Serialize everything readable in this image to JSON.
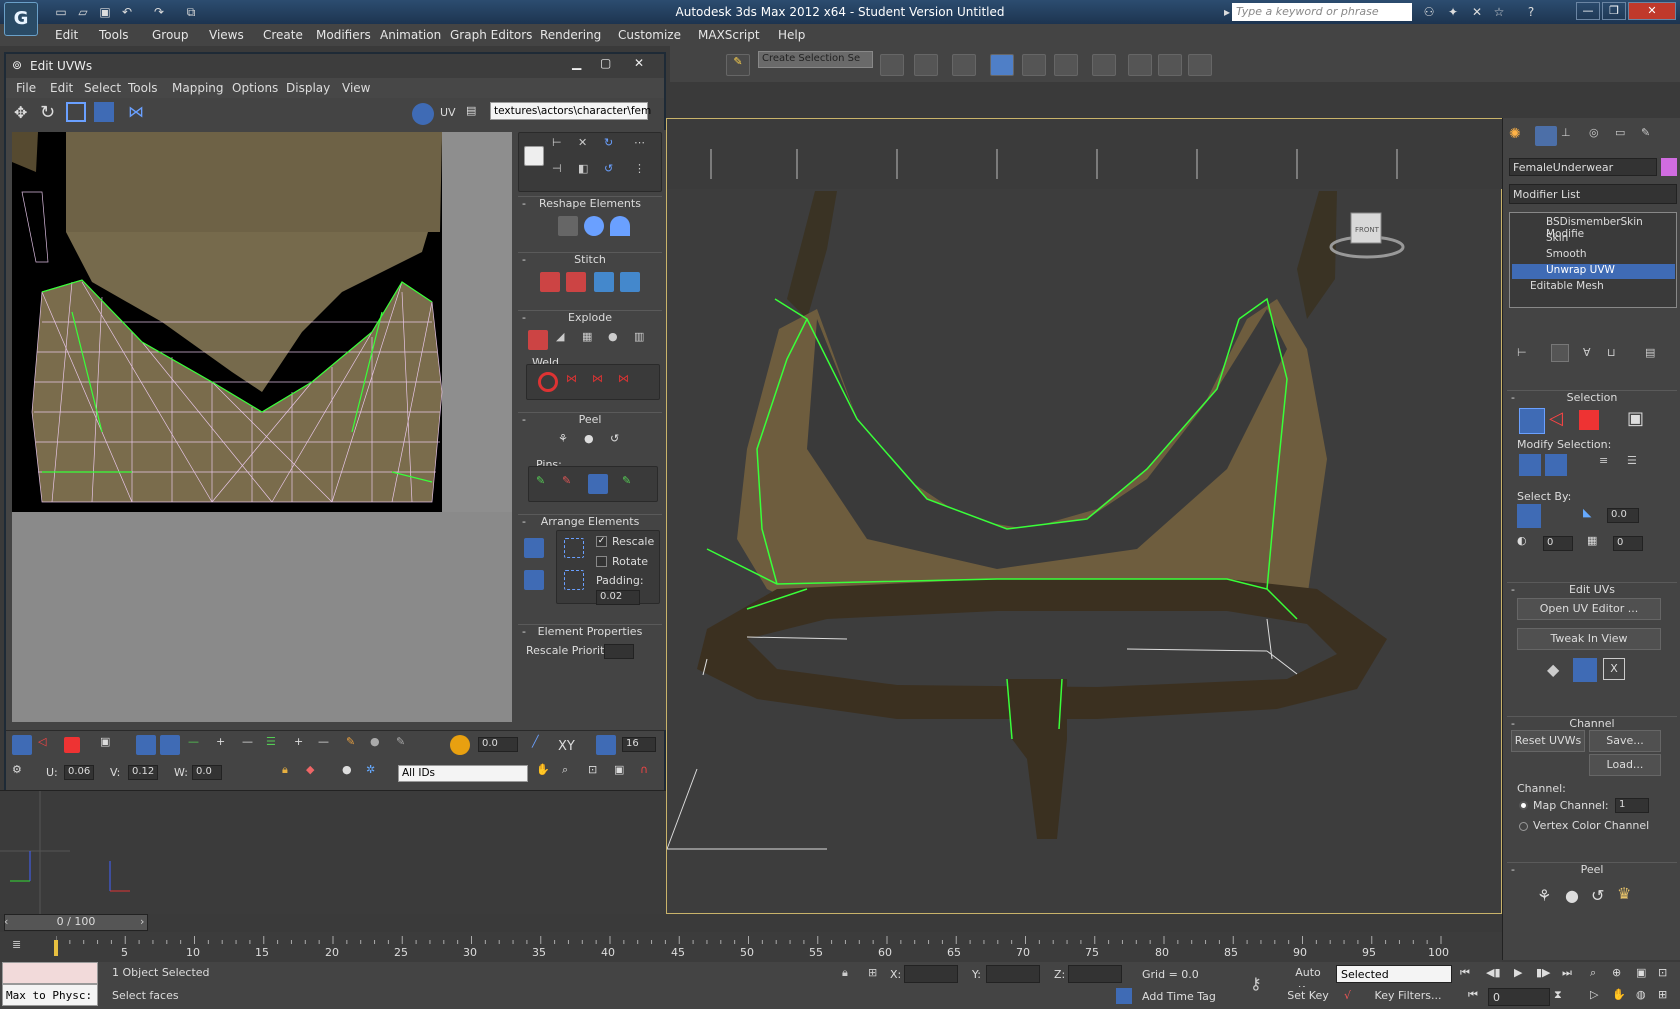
{
  "app": {
    "title": "Autodesk 3ds Max  2012 x64   - Student Version   Untitled",
    "search_placeholder": "Type a keyword or phrase",
    "menu": [
      "Edit",
      "Tools",
      "Group",
      "Views",
      "Create",
      "Modifiers",
      "Animation",
      "Graph Editors",
      "Rendering",
      "Customize",
      "MAXScript",
      "Help"
    ],
    "selection_set": "Create Selection Se"
  },
  "uv_editor": {
    "title": "Edit UVWs",
    "menu": [
      "File",
      "Edit",
      "Select",
      "Tools",
      "Mapping",
      "Options",
      "Display",
      "View"
    ],
    "uv_label": "UV",
    "texture_path": "textures\\actors\\character\\fem",
    "panels": {
      "reshape": "Reshape Elements",
      "stitch": "Stitch",
      "explode": "Explode",
      "weld": "Weld",
      "peel": "Peel",
      "pins": "Pins:",
      "arrange": "Arrange Elements",
      "rescale": "Rescale",
      "rotate": "Rotate",
      "padding_label": "Padding:",
      "padding_value": "0.02",
      "element_props": "Element Properties",
      "rescale_priority": "Rescale Priority:"
    },
    "bottom": {
      "soft_val": "0.0",
      "xy": "XY",
      "grid_val": "16",
      "u_label": "U:",
      "u_val": "0.06",
      "v_label": "V:",
      "v_val": "0.12",
      "w_label": "W:",
      "w_val": "0.0",
      "ids": "All IDs"
    }
  },
  "command_panel": {
    "object_name": "FemaleUnderwear",
    "modifier_list": "Modifier List",
    "stack": [
      {
        "label": "BSDismemberSkin Modifie",
        "selected": false
      },
      {
        "label": "Skin",
        "selected": false
      },
      {
        "label": "Smooth",
        "selected": false
      },
      {
        "label": "Unwrap UVW",
        "selected": true
      },
      {
        "label": "Editable Mesh",
        "selected": false
      }
    ],
    "selection": {
      "header": "Selection",
      "modify_selection": "Modify Selection:",
      "select_by": "Select By:",
      "angle_val": "0.0",
      "val1": "0",
      "val2": "0"
    },
    "edit_uvs": {
      "header": "Edit UVs",
      "open_editor": "Open UV Editor ...",
      "tweak": "Tweak In View"
    },
    "channel": {
      "header": "Channel",
      "reset": "Reset UVWs",
      "save": "Save...",
      "load": "Load...",
      "channel_label": "Channel:",
      "map_channel": "Map Channel:",
      "map_channel_val": "1",
      "vertex_color": "Vertex Color Channel"
    },
    "peel_header": "Peel"
  },
  "viewport": {
    "viewcube_label": "FRONT"
  },
  "timeline": {
    "slider": "0 / 100",
    "ticks": [
      "5",
      "10",
      "15",
      "20",
      "25",
      "30",
      "35",
      "40",
      "45",
      "50",
      "55",
      "60",
      "65",
      "70",
      "75",
      "80",
      "85",
      "90",
      "95",
      "100"
    ]
  },
  "status": {
    "maxscript": "Max to Physc:",
    "selected": "1 Object Selected",
    "prompt": "Select faces",
    "x_label": "X:",
    "y_label": "Y:",
    "z_label": "Z:",
    "grid": "Grid = 0.0",
    "add_time_tag": "Add Time Tag",
    "auto_key": "Auto Key",
    "set_key": "Set Key",
    "key_mode": "Selected",
    "key_filters": "Key Filters...",
    "frame": "0"
  },
  "colors": {
    "accent": "#3f6bb5",
    "wire_green": "#39ff39",
    "uv_mesh": "#f3d0f7"
  }
}
